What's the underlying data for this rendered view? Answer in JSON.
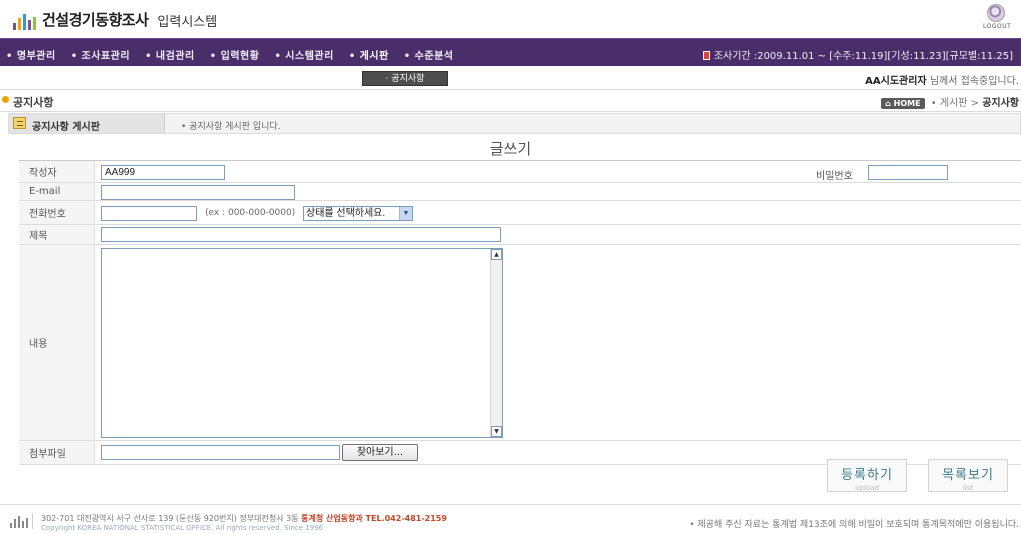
{
  "header": {
    "title_bold": "건설경기동향조사",
    "title_suffix": "입력시스템",
    "logout_label": "LOGOUT"
  },
  "nav": {
    "items": [
      "• 명부관리",
      "• 조사표관리",
      "• 내검관리",
      "• 입력현황",
      "• 시스템관리",
      "• 게시판",
      "• 수준분석"
    ],
    "period": "조사기간 :2009.11.01 ~ [수주:11.19][기성:11.23][규모별:11.25]"
  },
  "subnav": {
    "tab": "· 공지사항",
    "user_name": "AA시도관리자",
    "user_suffix": "님께서 접속중입니다."
  },
  "page": {
    "title": "공지사항",
    "home": "HOME",
    "crumb_mid": "• 게시판 >",
    "crumb_last": "공지사항"
  },
  "board": {
    "tab_prefix": "공지사항",
    "tab_label": "게시판",
    "desc": "• 공지사항 게시판 입니다."
  },
  "form": {
    "heading": "글쓰기",
    "author_label": "작성자",
    "author_value": "AA999",
    "password_label": "비밀번호",
    "email_label": "E-mail",
    "phone_label": "전화번호",
    "phone_hint": "(ex : 000-000-0000)",
    "status_select": "상태를 선택하세요.",
    "subject_label": "제목",
    "content_label": "내용",
    "attach_label": "첨부파일",
    "browse_button": "찾아보기..."
  },
  "buttons": {
    "register": "등록하기",
    "register_sub": "upload",
    "list": "목록보기",
    "list_sub": "list"
  },
  "footer": {
    "address": "302-701 대전광역시 서구 선사로 139 (둔산동 920번지) 정부대전청사 3동",
    "org": "통계청 산업동향과 TEL.042-481-2159",
    "copyright": "Copyright KOREA NATIONAL STATISTICAL OFFICE. All rights reserved. Since 1996",
    "notice": "• 제공해 주신 자료는 통계법 제13조에 의해 비밀이 보호되며 통계목적에만 이용됩니다."
  },
  "colors": {
    "nav_bg": "#4a2e6a",
    "accent_orange": "#f2a500",
    "button_text": "#3d7a8c"
  }
}
